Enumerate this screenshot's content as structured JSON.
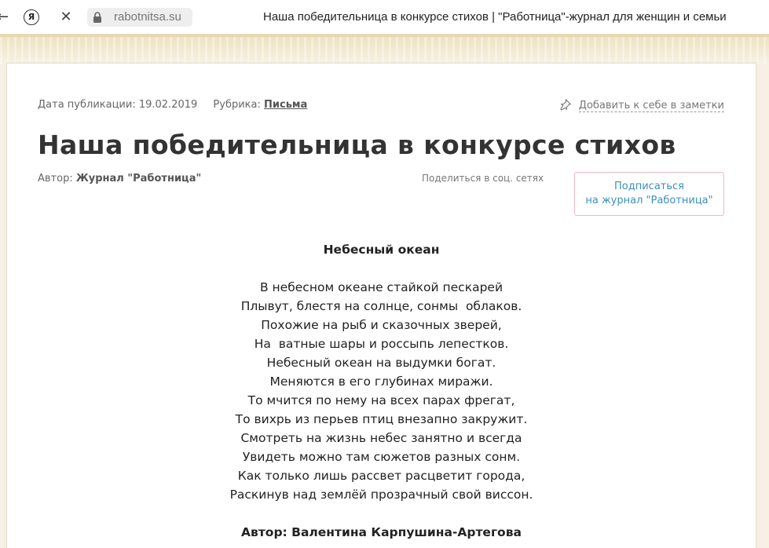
{
  "browser": {
    "url": "rabotnitsa.su",
    "tab_title": "Наша победительница в конкурсе стихов | \"Работница\"-журнал для женщин и семьи",
    "yandex_glyph": "Я",
    "close_glyph": "✕",
    "back_glyph": "←",
    "icons": [
      "back-icon",
      "yandex-icon",
      "close-icon",
      "lock-icon"
    ]
  },
  "article": {
    "pub_date_label": "Дата публикации: 19.02.2019",
    "rubric_label": "Рубрика:",
    "rubric_link": "Письма",
    "notes_label": "Добавить к себе в заметки",
    "title": "Наша победительница в конкурсе стихов",
    "author_label": "Автор:",
    "author_name": "Журнал \"Работница\"",
    "share_label": "Поделиться в соц. сетях",
    "subscribe_line1": "Подписаться",
    "subscribe_line2": "на журнал \"Работница\""
  },
  "poem": {
    "title": "Небесный океан",
    "lines": [
      "В небесном океане стайкой пескарей",
      "Плывут, блестя на солнце, сонмы  облаков.",
      "Похожие на рыб и сказочных зверей,",
      "На  ватные шары и россыпь лепестков.",
      "Небесный океан на выдумки богат.",
      "Меняются в его глубинах миражи.",
      "То мчится по нему на всех парах фрегат,",
      "То вихрь из перьев птиц внезапно закружит.",
      "Смотреть на жизнь небес занятно и всегда",
      "Увидеть можно там сюжетов разных сонм.",
      "Как только лишь рассвет расцветит города,",
      "Раскинув над землёй прозрачный свой виссон."
    ],
    "author": "Автор: Валентина Карпушина-Артегова"
  },
  "colors": {
    "page_bg": "#f6f1e4",
    "link_blue": "#3a8fbf",
    "subscribe_border": "#f0b8c0",
    "headline": "#333333"
  }
}
